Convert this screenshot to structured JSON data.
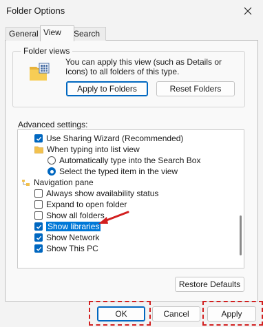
{
  "window": {
    "title": "Folder Options"
  },
  "tabs": [
    {
      "label": "General"
    },
    {
      "label": "View"
    },
    {
      "label": "Search"
    }
  ],
  "folder_views": {
    "group_label": "Folder views",
    "description": "You can apply this view (such as Details or Icons) to all folders of this type.",
    "apply_button": "Apply to Folders",
    "reset_button": "Reset Folders"
  },
  "advanced": {
    "label": "Advanced settings:",
    "items": [
      {
        "label": "Use Sharing Wizard (Recommended)",
        "kind": "checkbox",
        "checked": true
      },
      {
        "label": "When typing into list view",
        "kind": "folder"
      },
      {
        "label": "Automatically type into the Search Box",
        "kind": "radio",
        "checked": false
      },
      {
        "label": "Select the typed item in the view",
        "kind": "radio",
        "checked": true
      },
      {
        "label": "Navigation pane",
        "kind": "folder-nav"
      },
      {
        "label": "Always show availability status",
        "kind": "checkbox",
        "checked": false
      },
      {
        "label": "Expand to open folder",
        "kind": "checkbox",
        "checked": false
      },
      {
        "label": "Show all folders",
        "kind": "checkbox",
        "checked": false
      },
      {
        "label": "Show libraries",
        "kind": "checkbox",
        "checked": true
      },
      {
        "label": "Show Network",
        "kind": "checkbox",
        "checked": true
      },
      {
        "label": "Show This PC",
        "kind": "checkbox",
        "checked": true
      }
    ],
    "restore_button": "Restore Defaults"
  },
  "footer": {
    "ok": "OK",
    "cancel": "Cancel",
    "apply": "Apply"
  },
  "colors": {
    "accent": "#0067c0",
    "annotation": "#d21f1f"
  }
}
